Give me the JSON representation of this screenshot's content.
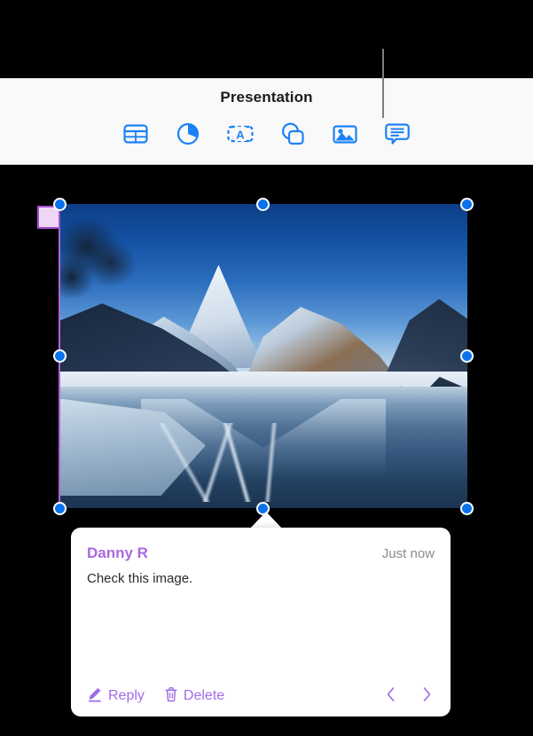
{
  "toolbar": {
    "title": "Presentation",
    "buttons": [
      {
        "name": "table-icon",
        "label": "Table"
      },
      {
        "name": "chart-icon",
        "label": "Chart"
      },
      {
        "name": "text-box-icon",
        "label": "Text"
      },
      {
        "name": "shape-icon",
        "label": "Shape"
      },
      {
        "name": "media-icon",
        "label": "Media"
      },
      {
        "name": "comment-icon",
        "label": "Comment"
      }
    ]
  },
  "canvas": {
    "image_alt": "Snow-covered mountains reflected in a still winter lake",
    "selection": {
      "handle_color": "#0a72ec",
      "anchor_color": "#a74fd0"
    }
  },
  "comment": {
    "author": "Danny R",
    "timestamp": "Just now",
    "text": "Check this image.",
    "accent_color": "#a06ce8",
    "actions": {
      "reply_label": "Reply",
      "delete_label": "Delete"
    },
    "nav": {
      "previous_label": "‹",
      "next_label": "›"
    }
  }
}
